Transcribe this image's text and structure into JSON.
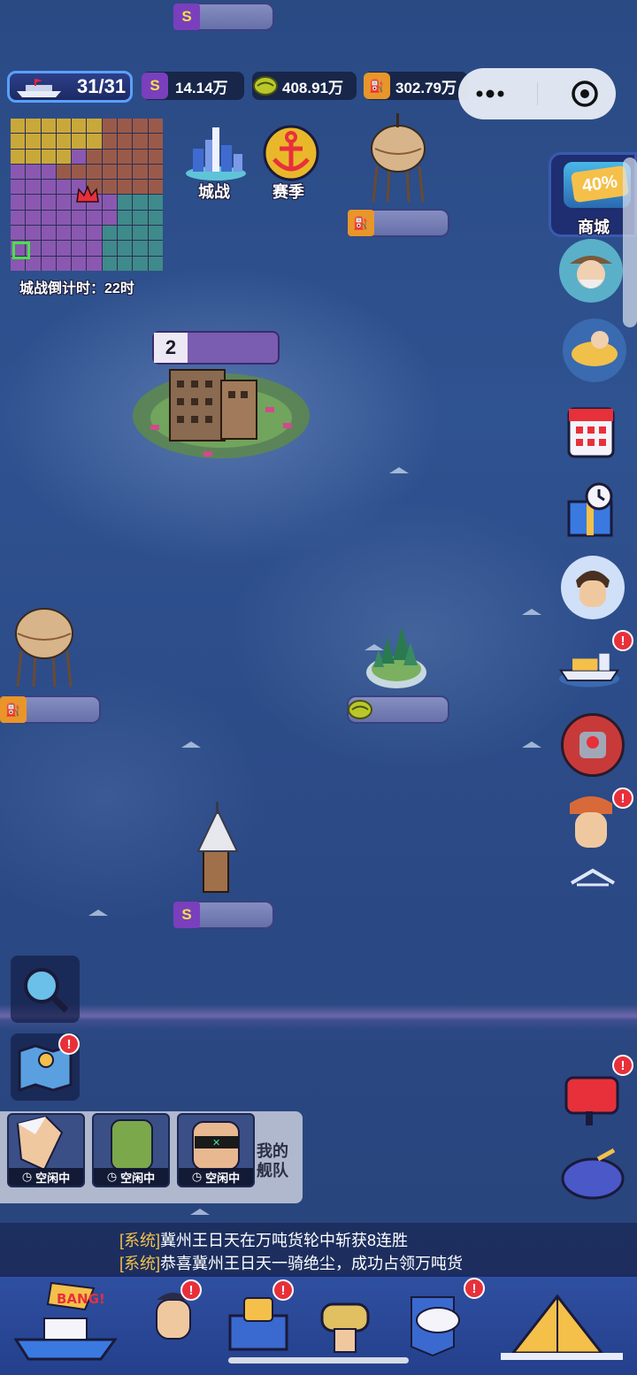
{
  "status_bar": {
    "ships": "31/31",
    "coins": "14.14万",
    "beans": "408.91万",
    "fuel": "302.79万"
  },
  "capsule": {
    "more_icon": "more-dots-icon",
    "close_icon": "target-circle-icon"
  },
  "map_buttons": {
    "city_war": "城战",
    "season": "赛季"
  },
  "minimap": {
    "countdown_label": "城战倒计时：",
    "countdown_value": "22时"
  },
  "island": {
    "level": "2"
  },
  "side_menu": {
    "shop_label": "商城",
    "shop_discount": "40%"
  },
  "fleet": {
    "label": "我的\n舰队",
    "members": [
      {
        "status": "空闲中"
      },
      {
        "status": "空闲中"
      },
      {
        "status": "空闲中"
      }
    ]
  },
  "chat": {
    "lines": [
      {
        "tag": "[系统]",
        "text": "冀州王日天在万吨货轮中斩获8连胜"
      },
      {
        "tag": "[系统]",
        "text": "恭喜冀州王日天一骑绝尘，成功占领万吨货"
      }
    ]
  },
  "bottom_bar": {
    "bang_label": "BANG!"
  },
  "colors": {
    "coin": "#7a3fbd",
    "bean": "#b8c82a",
    "fuel": "#e8962a",
    "alert": "#e8303a"
  }
}
